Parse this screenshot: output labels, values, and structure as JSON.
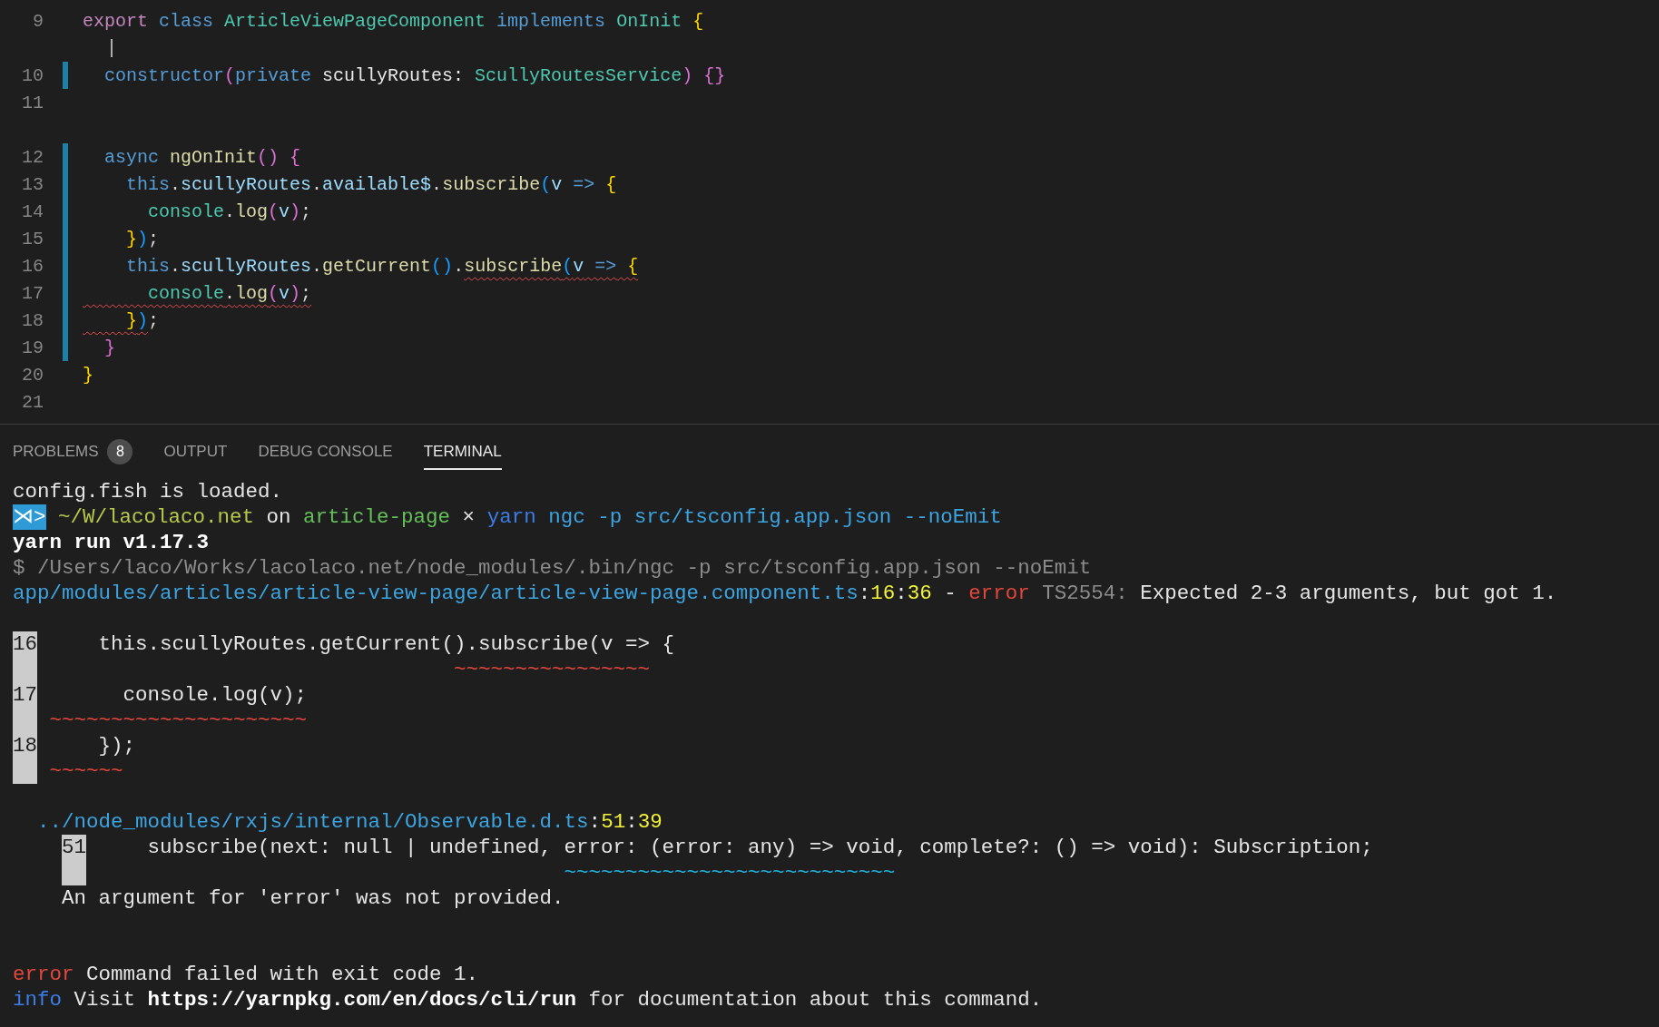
{
  "editor": {
    "lines": [
      {
        "kind": "code",
        "number": "9",
        "modified": false,
        "tokens": [
          {
            "text": "export",
            "kind": "keyword"
          },
          {
            "text": " class",
            "kind": "storage"
          },
          {
            "text": " ArticleViewPageComponent",
            "kind": "type"
          },
          {
            "text": " implements",
            "kind": "storage"
          },
          {
            "text": " OnInit",
            "kind": "type"
          },
          {
            "text": " {",
            "kind": "bracket-gold"
          }
        ]
      },
      {
        "kind": "caret"
      },
      {
        "kind": "code",
        "number": "10",
        "modified": true,
        "tokens": [
          {
            "text": "  constructor",
            "kind": "storage"
          },
          {
            "text": "(",
            "kind": "bracket-orchid"
          },
          {
            "text": "private",
            "kind": "storage"
          },
          {
            "text": " scullyRoutes: ",
            "kind": "plain"
          },
          {
            "text": "ScullyRoutesService",
            "kind": "type"
          },
          {
            "text": ")",
            "kind": "bracket-orchid"
          },
          {
            "text": " {}",
            "kind": "bracket-orchid"
          }
        ]
      },
      {
        "kind": "code",
        "number": "11",
        "modified": false
      },
      {
        "kind": "spacer"
      },
      {
        "kind": "code",
        "number": "12",
        "modified": true,
        "tokens": [
          {
            "text": "  async",
            "kind": "storage"
          },
          {
            "text": " ngOnInit",
            "kind": "function"
          },
          {
            "text": "()",
            "kind": "bracket-orchid"
          },
          {
            "text": " {",
            "kind": "bracket-orchid"
          }
        ]
      },
      {
        "kind": "code",
        "number": "13",
        "modified": true,
        "tokens": [
          {
            "text": "    this",
            "kind": "storage"
          },
          {
            "text": "."
          },
          {
            "text": "scullyRoutes",
            "kind": "variable"
          },
          {
            "text": "."
          },
          {
            "text": "available$",
            "kind": "variable"
          },
          {
            "text": "."
          },
          {
            "text": "subscribe",
            "kind": "function"
          },
          {
            "text": "(",
            "kind": "bracket-blue"
          },
          {
            "text": "v",
            "kind": "variable"
          },
          {
            "text": " =>",
            "kind": "storage"
          },
          {
            "text": " {",
            "kind": "bracket-gold"
          }
        ]
      },
      {
        "kind": "code",
        "number": "14",
        "modified": true,
        "tokens": [
          {
            "text": "      console",
            "kind": "type"
          },
          {
            "text": "."
          },
          {
            "text": "log",
            "kind": "function"
          },
          {
            "text": "(",
            "kind": "bracket-orchid"
          },
          {
            "text": "v",
            "kind": "variable"
          },
          {
            "text": ")",
            "kind": "bracket-orchid"
          },
          {
            "text": ";"
          }
        ]
      },
      {
        "kind": "code",
        "number": "15",
        "modified": true,
        "tokens": [
          {
            "text": "    }",
            "kind": "bracket-gold"
          },
          {
            "text": ")",
            "kind": "bracket-blue"
          },
          {
            "text": ";"
          }
        ]
      },
      {
        "kind": "code",
        "number": "16",
        "modified": true,
        "tokens": [
          {
            "text": "    this",
            "kind": "storage"
          },
          {
            "text": "."
          },
          {
            "text": "scullyRoutes",
            "kind": "variable"
          },
          {
            "text": "."
          },
          {
            "text": "getCurrent",
            "kind": "function"
          },
          {
            "text": "()",
            "kind": "bracket-blue"
          },
          {
            "text": "."
          },
          {
            "kind": "error-range",
            "tokens": [
              {
                "text": "subscribe",
                "kind": "function"
              },
              {
                "text": "(",
                "kind": "bracket-blue"
              },
              {
                "text": "v",
                "kind": "variable"
              },
              {
                "text": " =>",
                "kind": "storage"
              },
              {
                "text": " {",
                "kind": "bracket-gold"
              }
            ]
          }
        ]
      },
      {
        "kind": "code",
        "number": "17",
        "modified": true,
        "tokens": [
          {
            "kind": "error-range",
            "tokens": [
              {
                "text": "      console",
                "kind": "type"
              },
              {
                "text": "."
              },
              {
                "text": "log",
                "kind": "function"
              },
              {
                "text": "(",
                "kind": "bracket-orchid"
              },
              {
                "text": "v",
                "kind": "variable"
              },
              {
                "text": ")",
                "kind": "bracket-orchid"
              },
              {
                "text": ";"
              }
            ]
          }
        ]
      },
      {
        "kind": "code",
        "number": "18",
        "modified": true,
        "tokens": [
          {
            "kind": "error-range",
            "tokens": [
              {
                "text": "    }",
                "kind": "bracket-gold"
              },
              {
                "text": ")",
                "kind": "bracket-blue"
              }
            ]
          },
          {
            "text": ";"
          }
        ]
      },
      {
        "kind": "code",
        "number": "19",
        "modified": true,
        "tokens": [
          {
            "text": "  }",
            "kind": "bracket-orchid"
          }
        ]
      },
      {
        "kind": "code",
        "number": "20",
        "modified": false,
        "tokens": [
          {
            "text": "}",
            "kind": "bracket-gold"
          }
        ]
      },
      {
        "kind": "code",
        "number": "21",
        "modified": false
      }
    ]
  },
  "panel": {
    "tabs": [
      {
        "label": "PROBLEMS",
        "badge": "8",
        "selected": false
      },
      {
        "label": "OUTPUT",
        "selected": false
      },
      {
        "label": "DEBUG CONSOLE",
        "selected": false
      },
      {
        "label": "TERMINAL",
        "selected": true
      }
    ],
    "terminal": [
      {
        "kind": "text",
        "segments": [
          {
            "kind": "plain",
            "text": "config.fish is loaded."
          }
        ]
      },
      {
        "kind": "text",
        "segments": [
          {
            "kind": "prompt",
            "text": "⋊>"
          },
          {
            "kind": "olive",
            "text": " ~/W/lacolaco.net"
          },
          {
            "kind": "plain",
            "text": " on "
          },
          {
            "kind": "green",
            "text": "article-page"
          },
          {
            "kind": "plain",
            "text": " × "
          },
          {
            "kind": "command",
            "text": "yarn"
          },
          {
            "kind": "path",
            "text": " ngc -p src/tsconfig.app.json --noEmit"
          }
        ]
      },
      {
        "kind": "text",
        "segments": [
          {
            "kind": "bold",
            "text": "yarn run v1.17.3"
          }
        ]
      },
      {
        "kind": "text",
        "segments": [
          {
            "kind": "dim",
            "text": "$ /Users/laco/Works/lacolaco.net/node_modules/.bin/ngc -p src/tsconfig.app.json --noEmit"
          }
        ]
      },
      {
        "kind": "text",
        "segments": [
          {
            "kind": "path",
            "text": "app/modules/articles/article-view-page/article-view-page.component.ts"
          },
          {
            "kind": "plain",
            "text": ":"
          },
          {
            "kind": "yellow",
            "text": "16"
          },
          {
            "kind": "plain",
            "text": ":"
          },
          {
            "kind": "yellow",
            "text": "36"
          },
          {
            "kind": "plain",
            "text": " - "
          },
          {
            "kind": "error",
            "text": "error"
          },
          {
            "kind": "dim",
            "text": " TS2554:"
          },
          {
            "kind": "plain",
            "text": " Expected 2-3 arguments, but got 1."
          }
        ]
      },
      {
        "kind": "blank"
      },
      {
        "kind": "text",
        "segments": [
          {
            "kind": "gutter",
            "text": "16"
          },
          {
            "kind": "plain",
            "text": "     this.scullyRoutes.getCurrent().subscribe(v => {"
          }
        ]
      },
      {
        "kind": "text",
        "segments": [
          {
            "kind": "gutter-blank"
          },
          {
            "kind": "marker-red",
            "text": "                                  ~~~~~~~~~~~~~~~~"
          }
        ]
      },
      {
        "kind": "text",
        "segments": [
          {
            "kind": "gutter",
            "text": "17"
          },
          {
            "kind": "plain",
            "text": "       console.log(v);"
          }
        ]
      },
      {
        "kind": "text",
        "segments": [
          {
            "kind": "gutter-blank"
          },
          {
            "kind": "marker-red",
            "text": " ~~~~~~~~~~~~~~~~~~~~~"
          }
        ]
      },
      {
        "kind": "text",
        "segments": [
          {
            "kind": "gutter",
            "text": "18"
          },
          {
            "kind": "plain",
            "text": "     });"
          }
        ]
      },
      {
        "kind": "text",
        "segments": [
          {
            "kind": "gutter-blank"
          },
          {
            "kind": "marker-red",
            "text": " ~~~~~~"
          }
        ]
      },
      {
        "kind": "blank"
      },
      {
        "kind": "text",
        "segments": [
          {
            "kind": "path",
            "text": "  ../node_modules/rxjs/internal/Observable.d.ts"
          },
          {
            "kind": "plain",
            "text": ":"
          },
          {
            "kind": "yellow",
            "text": "51"
          },
          {
            "kind": "plain",
            "text": ":"
          },
          {
            "kind": "yellow",
            "text": "39"
          }
        ]
      },
      {
        "kind": "text",
        "indented": true,
        "segments": [
          {
            "kind": "gutter",
            "text": "51"
          },
          {
            "kind": "plain",
            "text": "     subscribe(next: null | undefined, error: (error: any) => void, complete?: () => void): Subscription;"
          }
        ]
      },
      {
        "kind": "text",
        "indented": true,
        "segments": [
          {
            "kind": "gutter-blank"
          },
          {
            "kind": "marker-cyan",
            "text": "                                       ~~~~~~~~~~~~~~~~~~~~~~~~~~~"
          }
        ]
      },
      {
        "kind": "text",
        "segments": [
          {
            "kind": "plain",
            "text": "    An argument for 'error' was not provided."
          }
        ]
      },
      {
        "kind": "blank"
      },
      {
        "kind": "blank"
      },
      {
        "kind": "text",
        "segments": [
          {
            "kind": "error",
            "text": "error"
          },
          {
            "kind": "plain",
            "text": " Command failed with exit code 1."
          }
        ]
      },
      {
        "kind": "text",
        "segments": [
          {
            "kind": "command",
            "text": "info"
          },
          {
            "kind": "plain",
            "text": " Visit "
          },
          {
            "kind": "bold",
            "text": "https://yarnpkg.com/en/docs/cli/run"
          },
          {
            "kind": "plain",
            "text": " for documentation about this command."
          }
        ]
      }
    ]
  }
}
